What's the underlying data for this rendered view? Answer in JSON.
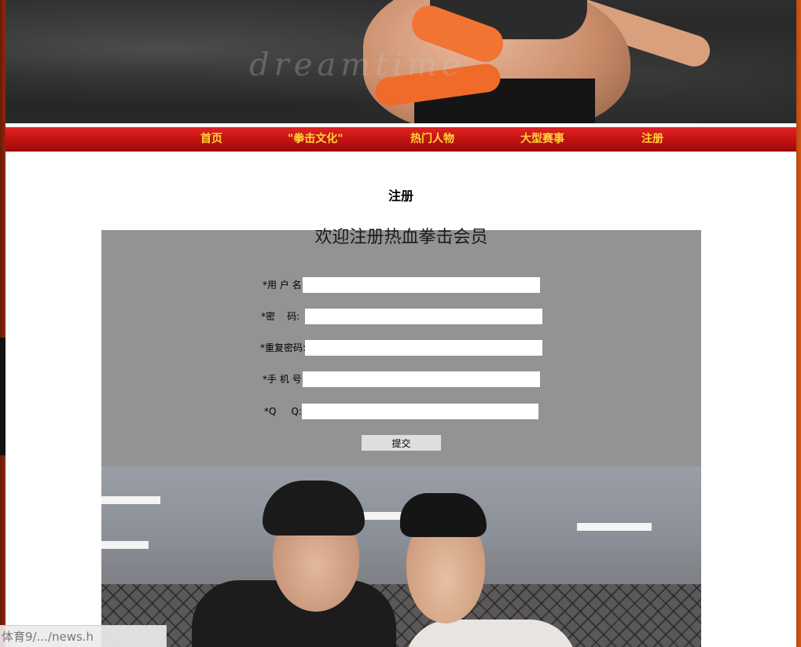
{
  "banner": {
    "watermark": "dreamtime"
  },
  "nav": {
    "items": [
      {
        "label": "首页"
      },
      {
        "label": "\"拳击文化\""
      },
      {
        "label": "热门人物"
      },
      {
        "label": "大型赛事"
      },
      {
        "label": "注册"
      }
    ]
  },
  "page": {
    "heading": "注册"
  },
  "form": {
    "title": "欢迎注册热血拳击会员",
    "fields": [
      {
        "label": "*用 户 名:",
        "value": ""
      },
      {
        "label": "*密    码:",
        "value": ""
      },
      {
        "label": "*重复密码:",
        "value": ""
      },
      {
        "label": "*手 机 号:",
        "value": ""
      },
      {
        "label": "*Q     Q:",
        "value": ""
      }
    ],
    "submit_label": "提交"
  },
  "status_bar": {
    "url": "体育9/.../news.h"
  },
  "colors": {
    "nav_red": "#c41212",
    "nav_text": "#ffd633",
    "form_bg": "#939393"
  }
}
